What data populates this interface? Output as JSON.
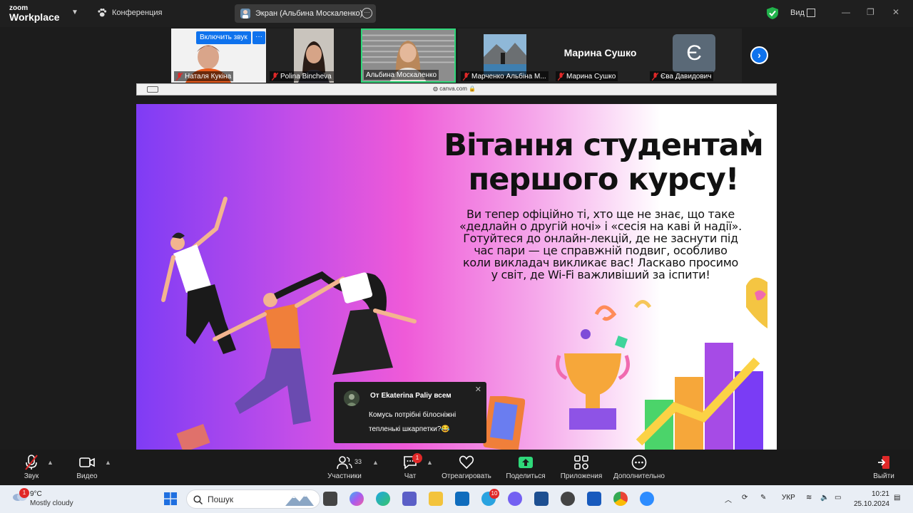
{
  "app": {
    "logo_line1": "zoom",
    "logo_line2": "Workplace",
    "conference_label": "Конференция",
    "screen_share_label": "Экран (Альбина Москаленко)",
    "view_label": "Вид"
  },
  "participants": [
    {
      "name": "Наталя Кукіна",
      "muted": true,
      "unmute_label": "Включить звук"
    },
    {
      "name": "Polina Bincheva",
      "muted": true
    },
    {
      "name": "Альбина Москаленко",
      "muted": false,
      "active": true
    },
    {
      "name": "Марченко Альбіна М...",
      "muted": true
    },
    {
      "name": "Марина Сушко",
      "muted": true,
      "display_name": "Марина Сушко"
    },
    {
      "name": "Єва Давидович",
      "muted": true,
      "avatar_letter": "Є"
    }
  ],
  "browser": {
    "url": "canva.com"
  },
  "slide": {
    "title": "Вітання студентам першого курсу!",
    "body": "Ви тепер офіційно ті, хто ще не знає, що таке «дедлайн о другій ночі» і «сесія на каві й надії». Готуйтеся до онлайн-лекцій, де не заснути під час пари — це справжній подвиг, особливо коли викладач викликає вас! Ласкаво просимо у світ, де Wi-Fi важливіший за іспити!"
  },
  "chat_toast": {
    "from": "От Ekaterina Paliy всем",
    "message": "Комусь потрібні білосніжні тепленькі шкарпетки?😂"
  },
  "controls": {
    "audio": "Звук",
    "video": "Видео",
    "participants": "Участники",
    "participants_count": "33",
    "chat": "Чат",
    "chat_badge": "1",
    "react": "Отреагировать",
    "share": "Поделиться",
    "apps": "Приложения",
    "more": "Дополнительно",
    "leave": "Выйти"
  },
  "taskbar": {
    "weather_temp": "9°C",
    "weather_cond": "Mostly cloudy",
    "weather_badge": "1",
    "search_placeholder": "Пошук",
    "language": "УКР",
    "time": "10:21",
    "date": "25.10.2024",
    "telegram_badge": "10"
  }
}
